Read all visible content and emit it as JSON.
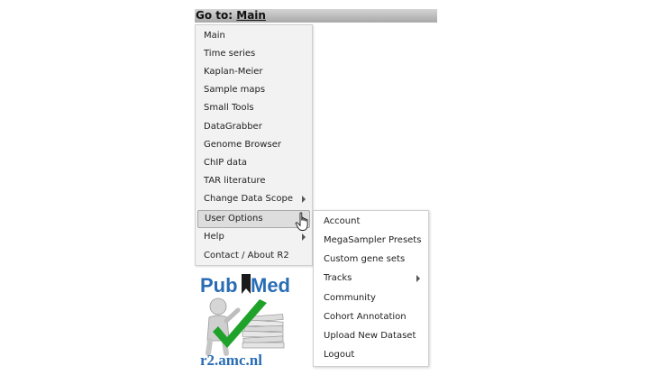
{
  "goto": {
    "prefix": "Go to:",
    "link": "Main"
  },
  "menu": {
    "items": [
      {
        "label": "Main"
      },
      {
        "label": "Time series"
      },
      {
        "label": "Kaplan-Meier"
      },
      {
        "label": "Sample maps"
      },
      {
        "label": "Small Tools"
      },
      {
        "label": "DataGrabber"
      },
      {
        "label": "Genome Browser"
      },
      {
        "label": "ChIP data"
      },
      {
        "label": "TAR literature"
      },
      {
        "label": "Change Data Scope",
        "submenu": true
      },
      {
        "label": "User Options",
        "submenu": true,
        "active": true
      },
      {
        "label": "Help",
        "submenu": true
      },
      {
        "label": "Contact / About R2"
      }
    ]
  },
  "submenu": {
    "items": [
      {
        "label": "Account"
      },
      {
        "label": "MegaSampler Presets"
      },
      {
        "label": "Custom gene sets"
      },
      {
        "label": "Tracks",
        "submenu": true
      },
      {
        "label": "Community"
      },
      {
        "label": "Cohort Annotation"
      },
      {
        "label": "Upload New Dataset"
      },
      {
        "label": "Logout"
      }
    ]
  },
  "logo": {
    "text_pub": "Pub",
    "text_med": "Med",
    "url": "r2.amc.nl",
    "colors": {
      "blue": "#2a6db5",
      "green": "#1fa22a"
    }
  }
}
